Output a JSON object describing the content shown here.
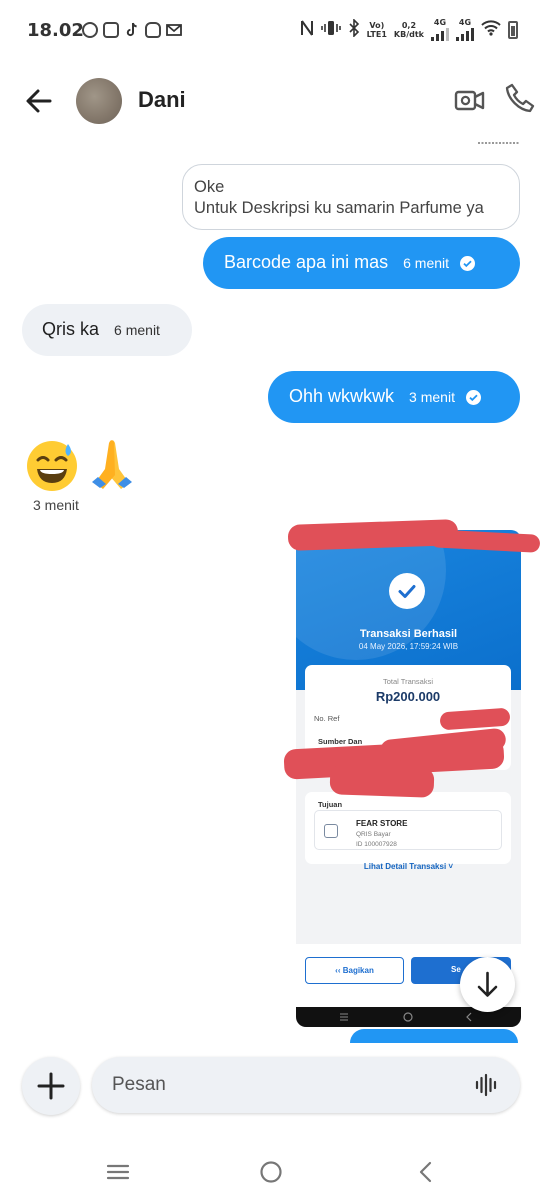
{
  "status_bar": {
    "time": "18.02",
    "network_speed": "0,2",
    "network_unit": "KB/dtk",
    "volte": "Vo)",
    "lte": "LTE1",
    "gen1": "4G",
    "gen2": "4G"
  },
  "header": {
    "contact_name": "Dani"
  },
  "messages": {
    "quote_line1": "Oke",
    "quote_line2": "Untuk Deskripsi ku samarin Parfume ya",
    "barcode_text": "Barcode apa ini mas",
    "barcode_time": "6 menit",
    "qris_text": "Qris ka",
    "qris_time": "6 menit",
    "ohh_text": "Ohh wkwkwk",
    "ohh_time": "3 menit",
    "emoji_text": "😅🙏",
    "emoji_time": "3 menit"
  },
  "receipt": {
    "title": "Transaksi Berhasil",
    "date": "04 May 2026, 17:59:24 WIB",
    "total_label": "Total Transaksi",
    "total_value": "Rp200.000",
    "ref_label": "No. Ref",
    "sumber_label": "Sumber Dan",
    "tujuan_label": "Tujuan",
    "store_name": "FEAR STORE",
    "store_type": "QRIS Bayar",
    "store_id": "ID 100007928",
    "detail_link": "Lihat Detail Transaksi ˅",
    "share_label": "Bagikan",
    "done_label": "Se"
  },
  "composer": {
    "placeholder": "Pesan"
  },
  "colors": {
    "outgoing_bubble": "#2196f3",
    "incoming_bubble": "#eef1f5",
    "redaction": "#e05058"
  },
  "icons": {
    "back": "arrow-left-icon",
    "video": "video-camera-icon",
    "call": "phone-icon",
    "add": "plus-icon",
    "voice": "voice-wave-icon",
    "scroll": "arrow-down-icon"
  }
}
